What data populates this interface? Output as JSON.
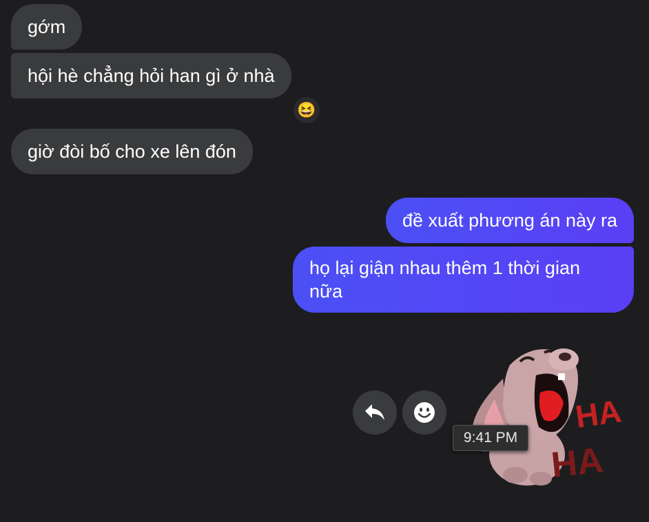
{
  "received": [
    "gớm",
    "hội hè chẳng hỏi han gì ở nhà",
    "giờ đòi bố cho xe lên đón"
  ],
  "reaction_emoji": "😆",
  "sent": [
    "đề xuất phương án này ra",
    "họ lại giận nhau thêm 1 thời gian nữa"
  ],
  "sticker": {
    "text_top": "HA",
    "text_bottom": "HA"
  },
  "tooltip_time": "9:41 PM",
  "colors": {
    "background": "#1d1d20",
    "received_bubble": "#3a3b3d",
    "sent_bubble_start": "#4b50f5",
    "sent_bubble_end": "#5a3ff5"
  },
  "icons": [
    "reply-icon",
    "smiley-icon"
  ]
}
